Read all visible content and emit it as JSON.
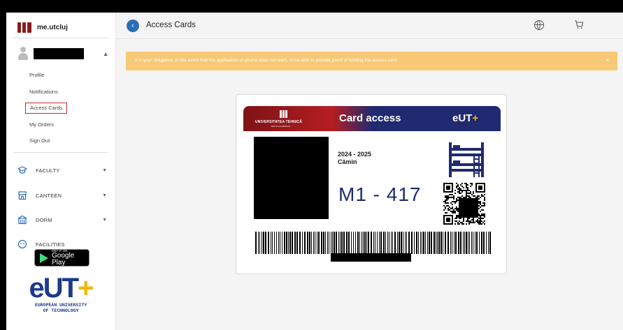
{
  "sidebar": {
    "brand": "me.utcluj",
    "menu": [
      {
        "label": "Profile"
      },
      {
        "label": "Notifications"
      },
      {
        "label": "Access Cards"
      },
      {
        "label": "My Orders"
      },
      {
        "label": "Sign Out"
      }
    ],
    "sections": [
      {
        "label": "FACULTY",
        "icon": "graduation-cap-icon"
      },
      {
        "label": "CANTEEN",
        "icon": "shop-icon"
      },
      {
        "label": "DORM",
        "icon": "building-icon"
      },
      {
        "label": "FACILITIES",
        "icon": "facilities-icon"
      }
    ],
    "google_play": {
      "small": "GET IT ON",
      "big": "Google Play"
    },
    "eut": {
      "mark": "eUT",
      "plus": "+",
      "line1": "EUROPEAN UNIVERSITY",
      "line2": "OF TECHNOLOGY"
    }
  },
  "header": {
    "title": "Access Cards"
  },
  "alert": {
    "text": "It is your obligation, in the event that the application or phone does not work, to be able to provide proof of holding the access card.",
    "close": "×"
  },
  "card": {
    "uni_name": "UNIVERSITATEA TEHNICĂ",
    "uni_sub": "DIN CLUJ-NAPOCA",
    "title_a": "Card",
    "title_b": "access",
    "eut": "eUT",
    "eut_plus": "+",
    "year": "2024 - 2025",
    "type": "Cămin",
    "room": "M1 - 417"
  },
  "colors": {
    "accent_blue": "#2a6db5",
    "alert_bg": "#f8c876",
    "card_red": "#b51e22",
    "card_navy": "#1f2a70",
    "active_outline": "#c62828"
  }
}
